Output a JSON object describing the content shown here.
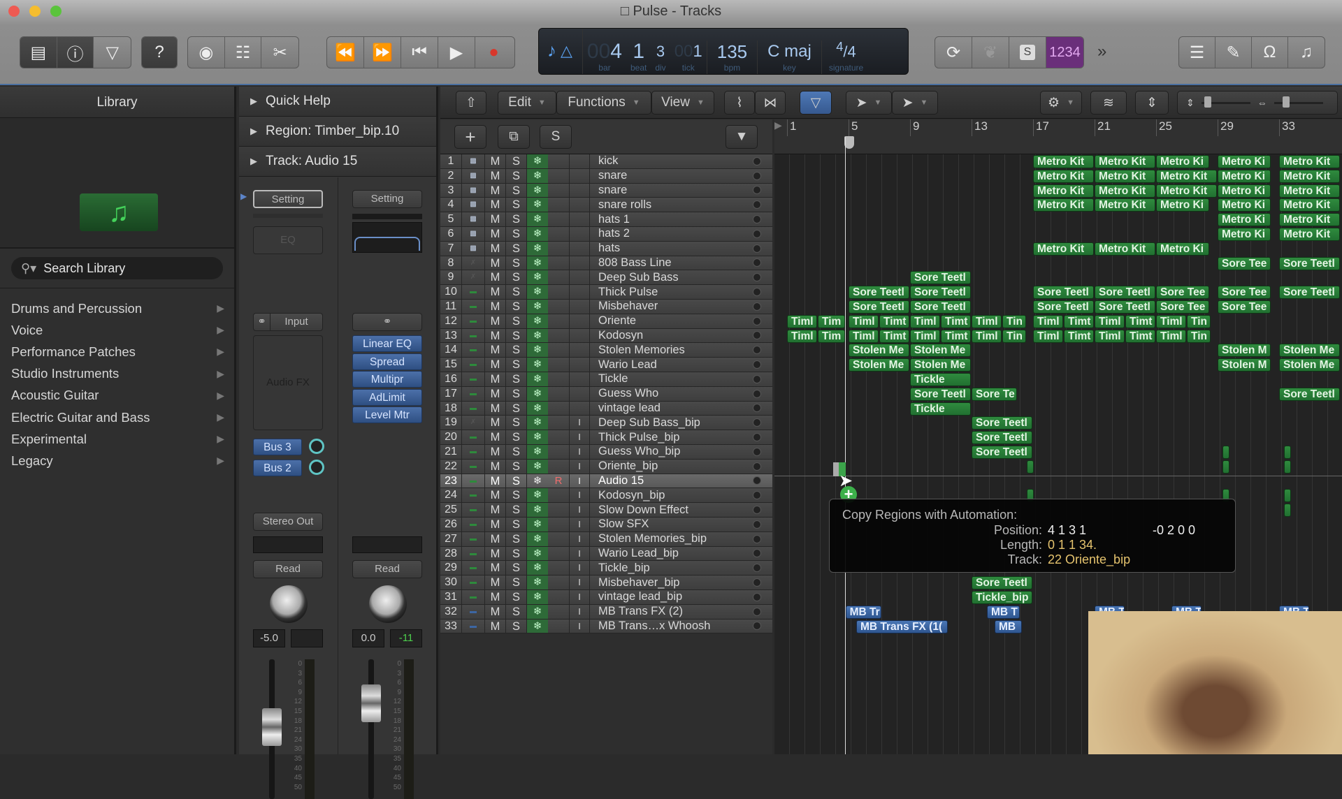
{
  "window": {
    "title": "Pulse - Tracks",
    "traffic_colors": [
      "#ee5a52",
      "#f5bd2f",
      "#5ac43c"
    ]
  },
  "toolbar": {
    "left_buttons": [
      "library-icon",
      "inspector-icon",
      "toolbar-icon"
    ],
    "help": "?",
    "mid_buttons": [
      "smart-controls-icon",
      "mixer-icon",
      "editors-icon"
    ],
    "transport": [
      "rewind-icon",
      "fast-forward-icon",
      "go-to-start-icon",
      "play-icon",
      "record-icon"
    ],
    "lcd": {
      "bar_dim": "00",
      "bar": "4",
      "beat": "1",
      "div": "3",
      "tick_dim": "00",
      "tick": "1",
      "bpm": "135",
      "key": "C maj",
      "signature_top": "4",
      "signature_bottom": "4",
      "labels": {
        "bar": "bar",
        "beat": "beat",
        "div": "div",
        "tick": "tick",
        "bpm": "bpm",
        "key": "key",
        "signature": "signature"
      }
    },
    "right_mode_buttons": [
      "cycle-icon",
      "tuner-icon",
      "solo-icon"
    ],
    "solo_label": "S",
    "count_in": "1234",
    "more": "»",
    "right_buttons": [
      "list-editors-icon",
      "note-pad-icon",
      "loop-browser-icon",
      "browser-icon"
    ]
  },
  "library": {
    "title": "Library",
    "search_placeholder": "Search Library",
    "items": [
      "Drums and Percussion",
      "Voice",
      "Performance Patches",
      "Studio Instruments",
      "Acoustic Guitar",
      "Electric Guitar and Bass",
      "Experimental",
      "Legacy"
    ]
  },
  "inspector": {
    "quick_help": "Quick Help",
    "region": "Region: Timber_bip.10",
    "track": "Track:  Audio 15",
    "strip1": {
      "setting": "Setting",
      "eq": "EQ",
      "input": "Input",
      "audio_fx": "Audio FX",
      "sends": [
        "Bus 3",
        "Bus 2"
      ],
      "output": "Stereo Out",
      "automation": "Read",
      "volume": "-5.0",
      "peak": ""
    },
    "strip2": {
      "setting": "Setting",
      "plugins": [
        "Linear EQ",
        "Spread",
        "Multipr",
        "AdLimit",
        "Level Mtr"
      ],
      "automation": "Read",
      "volume": "0.0",
      "peak": "-11"
    },
    "meter_scale": [
      "0",
      "3",
      "6",
      "9",
      "12",
      "15",
      "18",
      "21",
      "24",
      "30",
      "35",
      "40",
      "45",
      "50"
    ]
  },
  "tracks_toolbar": {
    "edit": "Edit",
    "functions": "Functions",
    "view": "View",
    "add_track": "+",
    "solo": "S"
  },
  "ruler": {
    "bars": [
      "1",
      "5",
      "9",
      "13",
      "17",
      "21",
      "25",
      "29",
      "33"
    ]
  },
  "tracks": [
    {
      "n": "1",
      "name": "kick",
      "type": "drum"
    },
    {
      "n": "2",
      "name": "snare",
      "type": "drum"
    },
    {
      "n": "3",
      "name": "snare",
      "type": "drum"
    },
    {
      "n": "4",
      "name": "snare rolls",
      "type": "drum"
    },
    {
      "n": "5",
      "name": "hats 1",
      "type": "drum"
    },
    {
      "n": "6",
      "name": "hats 2",
      "type": "drum"
    },
    {
      "n": "7",
      "name": "hats",
      "type": "drum"
    },
    {
      "n": "8",
      "name": "808 Bass Line",
      "type": "synth"
    },
    {
      "n": "9",
      "name": "Deep Sub Bass",
      "type": "synth"
    },
    {
      "n": "10",
      "name": "Thick Pulse",
      "type": "audio"
    },
    {
      "n": "11",
      "name": "Misbehaver",
      "type": "audio"
    },
    {
      "n": "12",
      "name": "Oriente",
      "type": "audio"
    },
    {
      "n": "13",
      "name": "Kodosyn",
      "type": "audio"
    },
    {
      "n": "14",
      "name": "Stolen Memories",
      "type": "audio"
    },
    {
      "n": "15",
      "name": "Wario Lead",
      "type": "audio"
    },
    {
      "n": "16",
      "name": "Tickle",
      "type": "audio"
    },
    {
      "n": "17",
      "name": "Guess Who",
      "type": "audio"
    },
    {
      "n": "18",
      "name": "vintage lead",
      "type": "audio"
    },
    {
      "n": "19",
      "name": "Deep Sub Bass_bip",
      "type": "synth",
      "input": "I"
    },
    {
      "n": "20",
      "name": "Thick Pulse_bip",
      "type": "audio",
      "input": "I"
    },
    {
      "n": "21",
      "name": "Guess Who_bip",
      "type": "audio",
      "input": "I"
    },
    {
      "n": "22",
      "name": "Oriente_bip",
      "type": "audio",
      "input": "I"
    },
    {
      "n": "23",
      "name": "Audio 15",
      "type": "audio",
      "input": "I",
      "record": "R",
      "selected": true
    },
    {
      "n": "24",
      "name": "Kodosyn_bip",
      "type": "audio",
      "input": "I"
    },
    {
      "n": "25",
      "name": "Slow Down Effect",
      "type": "audio",
      "input": "I"
    },
    {
      "n": "26",
      "name": "Slow SFX",
      "type": "audio",
      "input": "I"
    },
    {
      "n": "27",
      "name": "Stolen Memories_bip",
      "type": "audio",
      "input": "I"
    },
    {
      "n": "28",
      "name": "Wario Lead_bip",
      "type": "audio",
      "input": "I"
    },
    {
      "n": "29",
      "name": "Tickle_bip",
      "type": "audio",
      "input": "I"
    },
    {
      "n": "30",
      "name": "Misbehaver_bip",
      "type": "audio",
      "input": "I"
    },
    {
      "n": "31",
      "name": "vintage lead_bip",
      "type": "audio",
      "input": "I"
    },
    {
      "n": "32",
      "name": "MB Trans FX (2)",
      "type": "fx",
      "input": "I"
    },
    {
      "n": "33",
      "name": "MB Trans…x Whoosh",
      "type": "fx",
      "input": "I"
    }
  ],
  "track_labels": {
    "mute": "M",
    "solo": "S"
  },
  "regions": [
    {
      "track": 1,
      "bar": 17,
      "len": 4,
      "label": "Metro Kit"
    },
    {
      "track": 1,
      "bar": 21,
      "len": 4,
      "label": "Metro Kit"
    },
    {
      "track": 1,
      "bar": 25,
      "len": 3.5,
      "label": "Metro Ki"
    },
    {
      "track": 1,
      "bar": 29,
      "len": 3.5,
      "label": "Metro Ki"
    },
    {
      "track": 1,
      "bar": 33,
      "len": 4,
      "label": "Metro Kit"
    },
    {
      "track": 2,
      "bar": 17,
      "len": 4,
      "label": "Metro Kit"
    },
    {
      "track": 2,
      "bar": 21,
      "len": 4,
      "label": "Metro Kit"
    },
    {
      "track": 2,
      "bar": 25,
      "len": 4,
      "label": "Metro Kit"
    },
    {
      "track": 2,
      "bar": 29,
      "len": 3.5,
      "label": "Metro Ki"
    },
    {
      "track": 2,
      "bar": 33,
      "len": 4,
      "label": "Metro Kit"
    },
    {
      "track": 3,
      "bar": 17,
      "len": 4,
      "label": "Metro Kit"
    },
    {
      "track": 3,
      "bar": 21,
      "len": 4,
      "label": "Metro Kit"
    },
    {
      "track": 3,
      "bar": 25,
      "len": 4,
      "label": "Metro Kit"
    },
    {
      "track": 3,
      "bar": 29,
      "len": 3.5,
      "label": "Metro Ki"
    },
    {
      "track": 3,
      "bar": 33,
      "len": 4,
      "label": "Metro Kit"
    },
    {
      "track": 4,
      "bar": 17,
      "len": 4,
      "label": "Metro Kit"
    },
    {
      "track": 4,
      "bar": 21,
      "len": 4,
      "label": "Metro Kit"
    },
    {
      "track": 4,
      "bar": 25,
      "len": 3.5,
      "label": "Metro Ki"
    },
    {
      "track": 4,
      "bar": 29,
      "len": 3.5,
      "label": "Metro Ki"
    },
    {
      "track": 4,
      "bar": 33,
      "len": 4,
      "label": "Metro Kit"
    },
    {
      "track": 5,
      "bar": 29,
      "len": 3.5,
      "label": "Metro Ki"
    },
    {
      "track": 5,
      "bar": 33,
      "len": 4,
      "label": "Metro Kit"
    },
    {
      "track": 6,
      "bar": 29,
      "len": 3.5,
      "label": "Metro Ki"
    },
    {
      "track": 6,
      "bar": 33,
      "len": 4,
      "label": "Metro Kit"
    },
    {
      "track": 7,
      "bar": 17,
      "len": 4,
      "label": "Metro Kit"
    },
    {
      "track": 7,
      "bar": 21,
      "len": 4,
      "label": "Metro Kit"
    },
    {
      "track": 7,
      "bar": 25,
      "len": 3.5,
      "label": "Metro Ki"
    },
    {
      "track": 8,
      "bar": 29,
      "len": 3.5,
      "label": "Sore Tee"
    },
    {
      "track": 8,
      "bar": 33,
      "len": 4,
      "label": "Sore Teetl"
    },
    {
      "track": 9,
      "bar": 9,
      "len": 4,
      "label": "Sore Teetl"
    },
    {
      "track": 10,
      "bar": 5,
      "len": 4,
      "label": "Sore Teetl"
    },
    {
      "track": 10,
      "bar": 9,
      "len": 4,
      "label": "Sore Teetl"
    },
    {
      "track": 10,
      "bar": 17,
      "len": 4,
      "label": "Sore Teetl"
    },
    {
      "track": 10,
      "bar": 21,
      "len": 4,
      "label": "Sore Teetl"
    },
    {
      "track": 10,
      "bar": 25,
      "len": 3.5,
      "label": "Sore Tee"
    },
    {
      "track": 10,
      "bar": 29,
      "len": 3.5,
      "label": "Sore Tee"
    },
    {
      "track": 10,
      "bar": 33,
      "len": 4,
      "label": "Sore Teetl"
    },
    {
      "track": 11,
      "bar": 5,
      "len": 4,
      "label": "Sore Teetl"
    },
    {
      "track": 11,
      "bar": 9,
      "len": 4,
      "label": "Sore Teetl"
    },
    {
      "track": 11,
      "bar": 17,
      "len": 4,
      "label": "Sore Teetl"
    },
    {
      "track": 11,
      "bar": 21,
      "len": 4,
      "label": "Sore Teetl"
    },
    {
      "track": 11,
      "bar": 25,
      "len": 3.5,
      "label": "Sore Tee"
    },
    {
      "track": 11,
      "bar": 29,
      "len": 3.5,
      "label": "Sore Tee"
    },
    {
      "track": 12,
      "bar": 1,
      "len": 2,
      "label": "Timl"
    },
    {
      "track": 12,
      "bar": 3,
      "len": 1.8,
      "label": "Tim"
    },
    {
      "track": 12,
      "bar": 5,
      "len": 2,
      "label": "Timl"
    },
    {
      "track": 12,
      "bar": 7,
      "len": 2,
      "label": "Timt"
    },
    {
      "track": 12,
      "bar": 9,
      "len": 2,
      "label": "Timl"
    },
    {
      "track": 12,
      "bar": 11,
      "len": 2,
      "label": "Timt"
    },
    {
      "track": 12,
      "bar": 13,
      "len": 2,
      "label": "Timl"
    },
    {
      "track": 12,
      "bar": 15,
      "len": 1.6,
      "label": "Tin"
    },
    {
      "track": 12,
      "bar": 17,
      "len": 2,
      "label": "Timl"
    },
    {
      "track": 12,
      "bar": 19,
      "len": 2,
      "label": "Timt"
    },
    {
      "track": 12,
      "bar": 21,
      "len": 2,
      "label": "Timl"
    },
    {
      "track": 12,
      "bar": 23,
      "len": 2,
      "label": "Timt"
    },
    {
      "track": 12,
      "bar": 25,
      "len": 2,
      "label": "Timl"
    },
    {
      "track": 12,
      "bar": 27,
      "len": 1.6,
      "label": "Tin"
    },
    {
      "track": 13,
      "bar": 1,
      "len": 2,
      "label": "Timl"
    },
    {
      "track": 13,
      "bar": 3,
      "len": 1.8,
      "label": "Tim"
    },
    {
      "track": 13,
      "bar": 5,
      "len": 2,
      "label": "Timl"
    },
    {
      "track": 13,
      "bar": 7,
      "len": 2,
      "label": "Timt"
    },
    {
      "track": 13,
      "bar": 9,
      "len": 2,
      "label": "Timl"
    },
    {
      "track": 13,
      "bar": 11,
      "len": 2,
      "label": "Timt"
    },
    {
      "track": 13,
      "bar": 13,
      "len": 2,
      "label": "Timl"
    },
    {
      "track": 13,
      "bar": 15,
      "len": 1.6,
      "label": "Tin"
    },
    {
      "track": 13,
      "bar": 17,
      "len": 2,
      "label": "Timl"
    },
    {
      "track": 13,
      "bar": 19,
      "len": 2,
      "label": "Timt"
    },
    {
      "track": 13,
      "bar": 21,
      "len": 2,
      "label": "Timl"
    },
    {
      "track": 13,
      "bar": 23,
      "len": 2,
      "label": "Timt"
    },
    {
      "track": 13,
      "bar": 25,
      "len": 2,
      "label": "Timl"
    },
    {
      "track": 13,
      "bar": 27,
      "len": 1.6,
      "label": "Tin"
    },
    {
      "track": 14,
      "bar": 5,
      "len": 4,
      "label": "Stolen Me"
    },
    {
      "track": 14,
      "bar": 9,
      "len": 4,
      "label": "Stolen Me"
    },
    {
      "track": 14,
      "bar": 29,
      "len": 3.5,
      "label": "Stolen M"
    },
    {
      "track": 14,
      "bar": 33,
      "len": 4,
      "label": "Stolen Me"
    },
    {
      "track": 15,
      "bar": 5,
      "len": 4,
      "label": "Stolen Me"
    },
    {
      "track": 15,
      "bar": 9,
      "len": 4,
      "label": "Stolen Me"
    },
    {
      "track": 15,
      "bar": 29,
      "len": 3.5,
      "label": "Stolen M"
    },
    {
      "track": 15,
      "bar": 33,
      "len": 4,
      "label": "Stolen Me"
    },
    {
      "track": 16,
      "bar": 9,
      "len": 4,
      "label": "Tickle"
    },
    {
      "track": 17,
      "bar": 9,
      "len": 4,
      "label": "Sore Teetl"
    },
    {
      "track": 17,
      "bar": 13,
      "len": 3,
      "label": "Sore Te"
    },
    {
      "track": 17,
      "bar": 33,
      "len": 4,
      "label": "Sore Teetl"
    },
    {
      "track": 18,
      "bar": 9,
      "len": 4,
      "label": "Tickle"
    },
    {
      "track": 19,
      "bar": 13,
      "len": 4,
      "label": "Sore Teetl"
    },
    {
      "track": 20,
      "bar": 13,
      "len": 4,
      "label": "Sore Teetl"
    },
    {
      "track": 21,
      "bar": 13,
      "len": 4,
      "label": "Sore Teetl"
    },
    {
      "track": 21,
      "bar": 29.3,
      "len": 0.5,
      "label": ""
    },
    {
      "track": 21,
      "bar": 33.3,
      "len": 0.5,
      "label": ""
    },
    {
      "track": 22,
      "bar": 16.6,
      "len": 0.5,
      "label": ""
    },
    {
      "track": 22,
      "bar": 29.3,
      "len": 0.5,
      "label": ""
    },
    {
      "track": 22,
      "bar": 33.3,
      "len": 0.5,
      "label": ""
    },
    {
      "track": 24,
      "bar": 16.6,
      "len": 0.5,
      "label": ""
    },
    {
      "track": 24,
      "bar": 29.3,
      "len": 0.5,
      "label": ""
    },
    {
      "track": 24,
      "bar": 33.3,
      "len": 0.5,
      "label": ""
    },
    {
      "track": 25,
      "bar": 33.3,
      "len": 0.5,
      "label": ""
    },
    {
      "track": 30,
      "bar": 13,
      "len": 4,
      "label": "Sore Teetl"
    },
    {
      "track": 31,
      "bar": 13,
      "len": 4,
      "label": "Tickle_bip"
    },
    {
      "track": 32,
      "bar": 4.8,
      "len": 2.4,
      "label": "MB Tr",
      "color": "blue"
    },
    {
      "track": 32,
      "bar": 14,
      "len": 2.2,
      "label": "MB T",
      "color": "blue"
    },
    {
      "track": 32,
      "bar": 21,
      "len": 2,
      "label": "MB T",
      "color": "blue"
    },
    {
      "track": 32,
      "bar": 26,
      "len": 2,
      "label": "MB T",
      "color": "blue"
    },
    {
      "track": 32,
      "bar": 33,
      "len": 2,
      "label": "MB T",
      "color": "blue"
    },
    {
      "track": 33,
      "bar": 5.5,
      "len": 6,
      "label": "MB Trans FX (1(",
      "color": "blue"
    },
    {
      "track": 33,
      "bar": 14.5,
      "len": 1.8,
      "label": "MB",
      "color": "blue"
    }
  ],
  "drag_tooltip": {
    "title": "Copy Regions with Automation:",
    "position_label": "Position:",
    "position": "4 1 3 1",
    "delta": "-0 2 0 0",
    "length_label": "Length:",
    "length": "0 1 1 34.",
    "track_label": "Track:",
    "track": "22  Oriente_bip"
  },
  "colors": {
    "region_green": "#2a7d38",
    "region_blue": "#3c66a3",
    "accent_blue": "#4a6fa0",
    "count_in_purple": "#6a2f7a"
  }
}
